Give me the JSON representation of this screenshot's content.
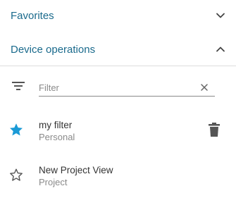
{
  "sections": {
    "favorites": {
      "title": "Favorites",
      "expanded": false,
      "chevron_icon": "chevron-down-icon"
    },
    "device_operations": {
      "title": "Device operations",
      "expanded": true,
      "chevron_icon": "chevron-up-icon"
    }
  },
  "filter": {
    "value": "",
    "placeholder": "Filter",
    "filter_icon": "filter-list-icon",
    "clear_icon": "close-icon"
  },
  "filters": [
    {
      "name": "my filter",
      "type": "Personal",
      "favorite": true,
      "star_icon": "star-filled-icon",
      "delete_icon": "trash-icon"
    },
    {
      "name": "New Project View",
      "type": "Project",
      "favorite": false,
      "star_icon": "star-outline-icon"
    }
  ],
  "colors": {
    "section_title": "#1a6a8c",
    "star_active": "#1a9ad6",
    "icon_gray": "#555555",
    "secondary_text": "#8a8a8a",
    "divider": "#dddddd"
  }
}
